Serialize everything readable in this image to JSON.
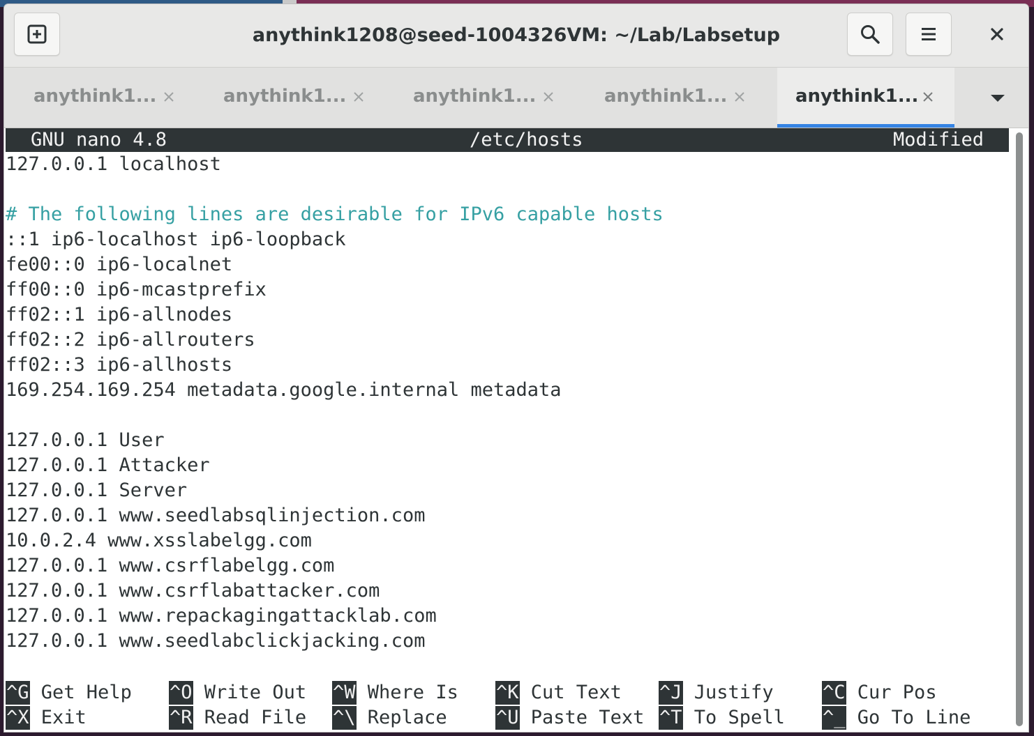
{
  "window": {
    "title": "anythink1208@seed-1004326VM: ~/Lab/Labsetup"
  },
  "header_buttons": {
    "new_tab_icon": "new-tab-icon",
    "search_icon": "search-icon",
    "menu_icon": "hamburger-menu-icon",
    "close_icon": "close-icon"
  },
  "tabs": [
    {
      "label": "anythink1...",
      "active": false
    },
    {
      "label": "anythink1...",
      "active": false
    },
    {
      "label": "anythink1...",
      "active": false
    },
    {
      "label": "anythink1...",
      "active": false
    },
    {
      "label": "anythink1...",
      "active": true
    }
  ],
  "accent_color": "#3584e4",
  "nano": {
    "version": "GNU nano 4.8",
    "filename": "/etc/hosts",
    "status": "Modified",
    "lines": [
      "127.0.0.1 localhost",
      "",
      "# The following lines are desirable for IPv6 capable hosts",
      "::1 ip6-localhost ip6-loopback",
      "fe00::0 ip6-localnet",
      "ff00::0 ip6-mcastprefix",
      "ff02::1 ip6-allnodes",
      "ff02::2 ip6-allrouters",
      "ff02::3 ip6-allhosts",
      "169.254.169.254 metadata.google.internal metadata",
      "",
      "127.0.0.1 User",
      "127.0.0.1 Attacker",
      "127.0.0.1 Server",
      "127.0.0.1 www.seedlabsqlinjection.com",
      "10.0.2.4 www.xsslabelgg.com",
      "127.0.0.1 www.csrflabelgg.com",
      "127.0.0.1 www.csrflabattacker.com",
      "127.0.0.1 www.repackagingattacklab.com",
      "127.0.0.1 www.seedlabclickjacking.com"
    ],
    "shortcuts_row1": [
      {
        "key": "^G",
        "label": "Get Help"
      },
      {
        "key": "^O",
        "label": "Write Out"
      },
      {
        "key": "^W",
        "label": "Where Is"
      },
      {
        "key": "^K",
        "label": "Cut Text"
      },
      {
        "key": "^J",
        "label": "Justify"
      },
      {
        "key": "^C",
        "label": "Cur Pos"
      }
    ],
    "shortcuts_row2": [
      {
        "key": "^X",
        "label": "Exit"
      },
      {
        "key": "^R",
        "label": "Read File"
      },
      {
        "key": "^\\",
        "label": "Replace"
      },
      {
        "key": "^U",
        "label": "Paste Text"
      },
      {
        "key": "^T",
        "label": "To Spell"
      },
      {
        "key": "^_",
        "label": "Go To Line"
      }
    ]
  }
}
